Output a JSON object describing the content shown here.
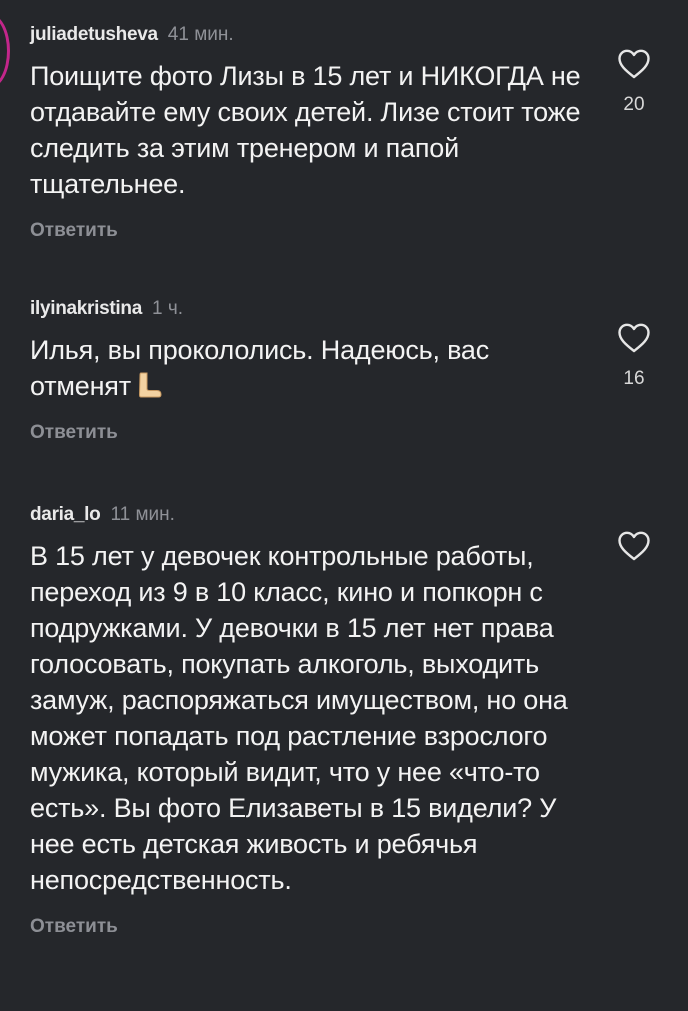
{
  "comments": [
    {
      "username": "juliadetusheva",
      "time": "41 мин.",
      "text": "Поищите фото Лизы в 15 лет и НИКОГДА не отдавайте ему своих детей. Лизе стоит тоже следить за этим тренером и папой тщательнее.",
      "likes": "20",
      "reply_label": "Ответить"
    },
    {
      "username": "ilyinakristina",
      "time": "1 ч.",
      "text": "Илья, вы прокололись. Надеюсь, вас отменят",
      "emoji": "foot-emoji",
      "likes": "16",
      "reply_label": "Ответить"
    },
    {
      "username": "daria_lo",
      "time": "11 мин.",
      "text": "В 15 лет у девочек контрольные работы, переход из 9 в 10 класс, кино и попкорн с подружками. У девочки в 15 лет нет права голосовать, покупать алкоголь, выходить замуж, распоряжаться имуществом, но она может попадать под растление взрослого мужика, который видит, что у нее «что-то есть». Вы фото Елизаветы в 15 видели? У нее есть детская живость и ребячья непосредственность.",
      "likes": "",
      "reply_label": "Ответить"
    }
  ],
  "icons": {
    "like": "heart-outline-icon",
    "avatar_ring": "story-ring"
  },
  "colors": {
    "background": "#25272b",
    "text": "#f3f3f3",
    "secondary": "#8f9197",
    "story_ring": "#c3268b"
  }
}
